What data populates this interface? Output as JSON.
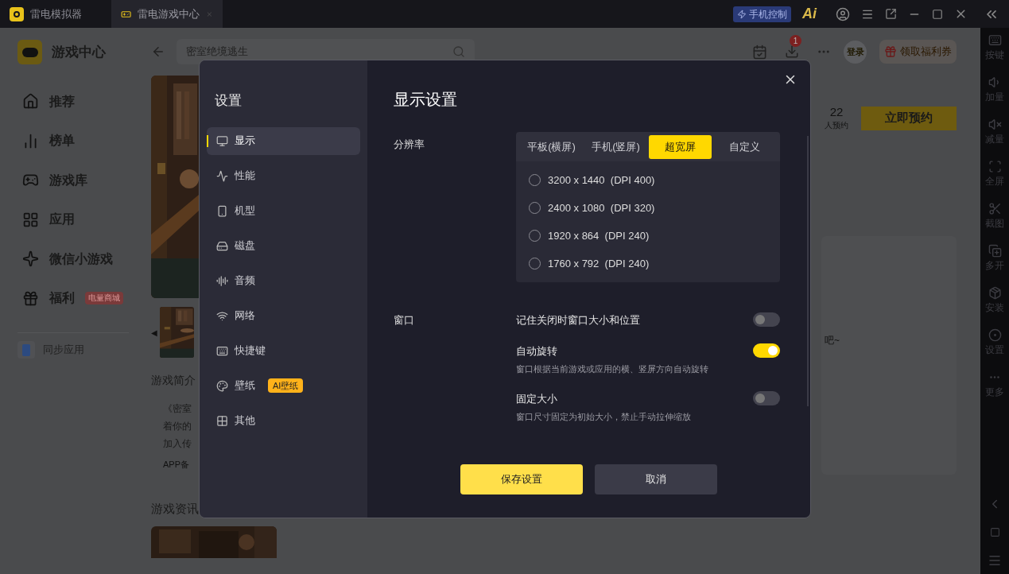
{
  "titlebar": {
    "tabs": [
      {
        "label": "雷电模拟器",
        "selected": false,
        "closable": false
      },
      {
        "label": "雷电游戏中心",
        "selected": true,
        "closable": true
      }
    ],
    "phone_control": "手机控制",
    "ai_logo": "Ai"
  },
  "app": {
    "title": "游戏中心",
    "nav": [
      {
        "label": "推荐"
      },
      {
        "label": "榜单"
      },
      {
        "label": "游戏库"
      },
      {
        "label": "应用"
      },
      {
        "label": "微信小游戏"
      },
      {
        "label": "福利",
        "badge": "电量商城"
      }
    ],
    "sync": "同步应用",
    "search": {
      "value": "密室绝境逃生"
    },
    "download_badge": "1",
    "login": "登录",
    "coupon": "领取福利券",
    "reserve_count": "22",
    "reserve_label": "人预约",
    "reserve_button": "立即预约",
    "prev_arrow": "◀",
    "intro_title": "游戏简介",
    "intro_lines": [
      "《密室",
      "着你的",
      "加入传"
    ],
    "record": "APP备",
    "news_title": "游戏资讯",
    "card_text": "吧~"
  },
  "toolbar": {
    "items": [
      {
        "label": "按键"
      },
      {
        "label": "加量"
      },
      {
        "label": "减量"
      },
      {
        "label": "全屏"
      },
      {
        "label": "截图"
      },
      {
        "label": "多开"
      },
      {
        "label": "安装"
      },
      {
        "label": "设置"
      },
      {
        "label": "更多"
      }
    ]
  },
  "dialog": {
    "title": "设置",
    "nav": [
      {
        "label": "显示",
        "selected": true
      },
      {
        "label": "性能",
        "selected": false
      },
      {
        "label": "机型",
        "selected": false
      },
      {
        "label": "磁盘",
        "selected": false
      },
      {
        "label": "音频",
        "selected": false
      },
      {
        "label": "网络",
        "selected": false
      },
      {
        "label": "快捷键",
        "selected": false
      },
      {
        "label": "壁纸",
        "selected": false,
        "badge": "AI壁纸"
      },
      {
        "label": "其他",
        "selected": false
      }
    ],
    "heading": "显示设置",
    "resolution": {
      "label": "分辨率",
      "tabs": [
        {
          "label": "平板(横屏)",
          "selected": false
        },
        {
          "label": "手机(竖屏)",
          "selected": false
        },
        {
          "label": "超宽屏",
          "selected": true
        },
        {
          "label": "自定义",
          "selected": false
        }
      ],
      "options": [
        {
          "size": "3200 x 1440",
          "dpi": "(DPI 400)",
          "selected": false
        },
        {
          "size": "2400 x 1080",
          "dpi": "(DPI 320)",
          "selected": false
        },
        {
          "size": "1920 x 864",
          "dpi": "(DPI 240)",
          "selected": false
        },
        {
          "size": "1760 x 792",
          "dpi": "(DPI 240)",
          "selected": false
        }
      ]
    },
    "window": {
      "label": "窗口",
      "toggles": [
        {
          "label": "记住关闭时窗口大小和位置",
          "on": false
        },
        {
          "label": "自动旋转",
          "on": true,
          "description": "窗口根据当前游戏或应用的横、竖屏方向自动旋转"
        },
        {
          "label": "固定大小",
          "on": false,
          "description": "窗口尺寸固定为初始大小，禁止手动拉伸缩放"
        }
      ]
    },
    "save": "保存设置",
    "cancel": "取消"
  }
}
